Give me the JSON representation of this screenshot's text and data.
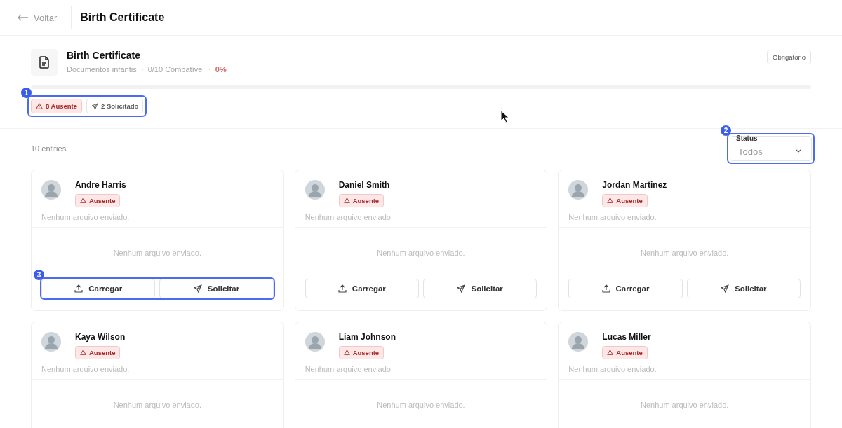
{
  "header": {
    "back": "Voltar",
    "title": "Birth Certificate"
  },
  "document": {
    "title": "Birth Certificate",
    "category": "Documentos infantis",
    "compat": "0/10 Compatível",
    "percent": "0%",
    "tag": "Obrigatório"
  },
  "summary": {
    "callout": "1",
    "badges": [
      {
        "kind": "missing",
        "label": "8 Ausente"
      },
      {
        "kind": "requested",
        "label": "2 Solicitado"
      }
    ]
  },
  "count": "10 entities",
  "filter": {
    "callout": "2",
    "label": "Status",
    "value": "Todos"
  },
  "cards": [
    {
      "name": "Andre Harris",
      "status": {
        "kind": "missing",
        "label": "Ausente"
      },
      "note": "Nenhum arquivo enviado.",
      "empty": "Nenhum arquivo enviado.",
      "callout": "3",
      "actions": [
        {
          "kind": "upload",
          "label": "Carregar"
        },
        {
          "kind": "request",
          "label": "Solicitar"
        }
      ]
    },
    {
      "name": "Daniel Smith",
      "status": {
        "kind": "missing",
        "label": "Ausente"
      },
      "note": "Nenhum arquivo enviado.",
      "empty": "Nenhum arquivo enviado.",
      "actions": [
        {
          "kind": "upload",
          "label": "Carregar"
        },
        {
          "kind": "request",
          "label": "Solicitar"
        }
      ]
    },
    {
      "name": "Jordan Martinez",
      "status": {
        "kind": "missing",
        "label": "Ausente"
      },
      "note": "Nenhum arquivo enviado.",
      "empty": "Nenhum arquivo enviado.",
      "actions": [
        {
          "kind": "upload",
          "label": "Carregar"
        },
        {
          "kind": "request",
          "label": "Solicitar"
        }
      ]
    },
    {
      "name": "Kaya Wilson",
      "status": {
        "kind": "missing",
        "label": "Ausente"
      },
      "note": "Nenhum arquivo enviado.",
      "empty": "Nenhum arquivo enviado."
    },
    {
      "name": "Liam Johnson",
      "status": {
        "kind": "missing",
        "label": "Ausente"
      },
      "note": "Nenhum arquivo enviado.",
      "empty": "Nenhum arquivo enviado."
    },
    {
      "name": "Lucas Miller",
      "status": {
        "kind": "missing",
        "label": "Ausente"
      },
      "note": "Nenhum arquivo enviado.",
      "empty": "Nenhum arquivo enviado."
    }
  ]
}
